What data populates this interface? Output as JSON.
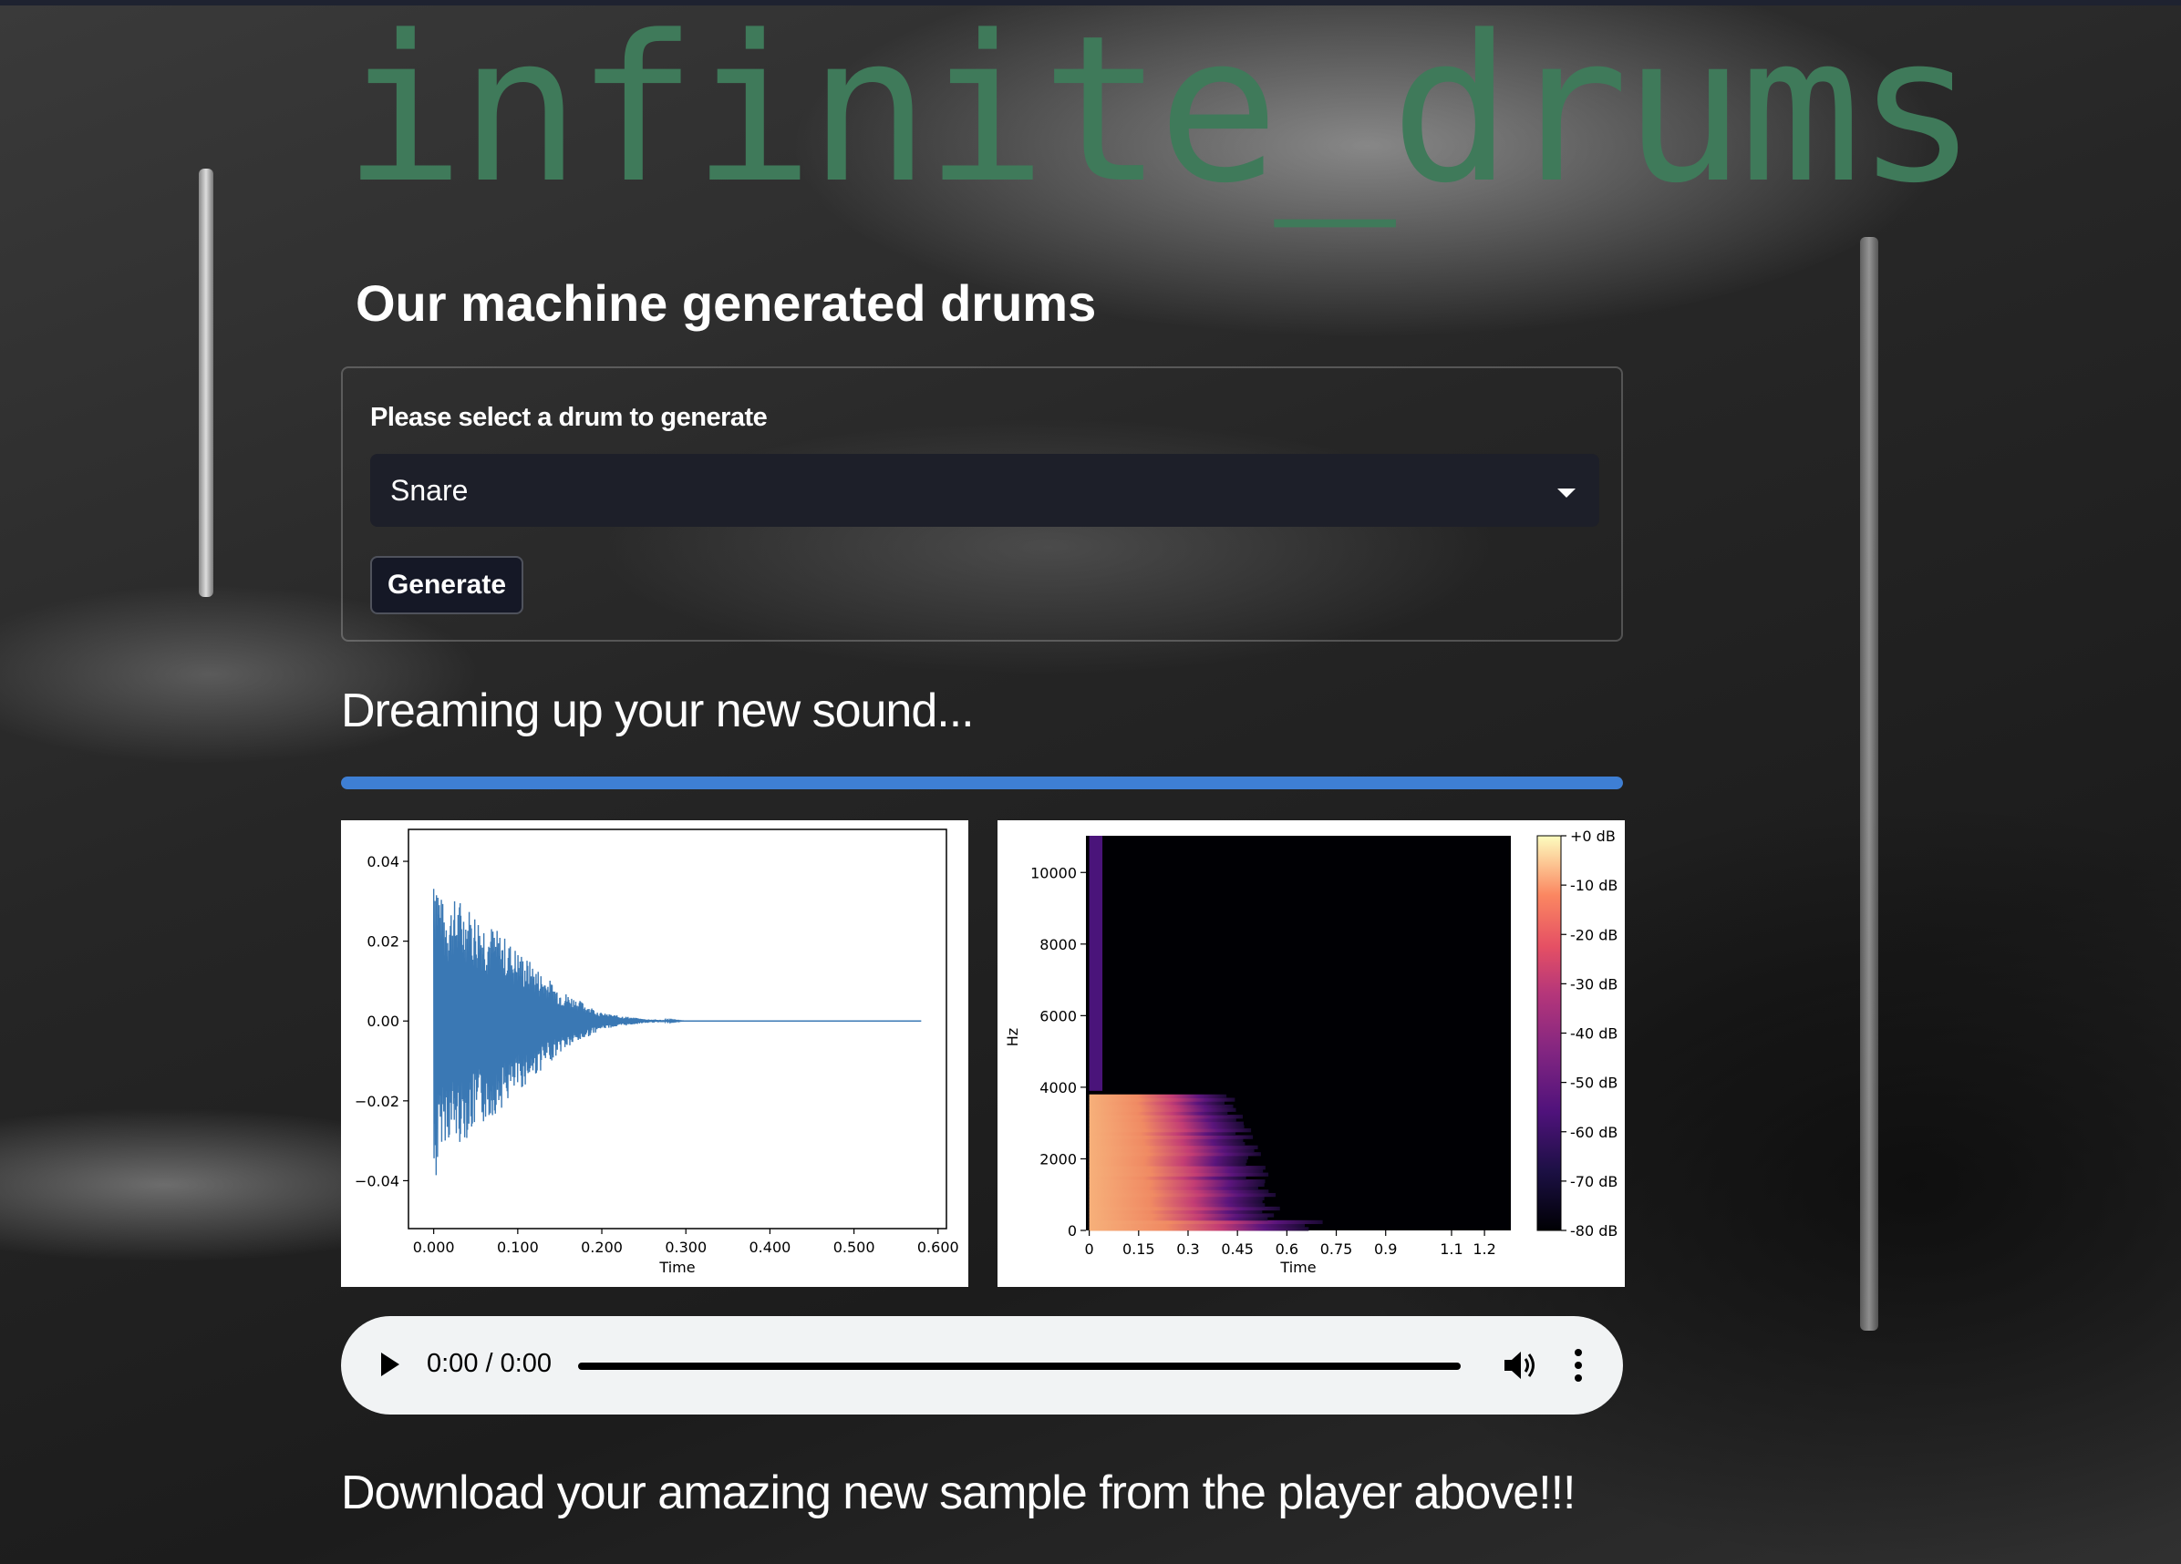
{
  "app": {
    "title": "infinite_drums"
  },
  "heading": "Our machine generated drums",
  "form": {
    "label": "Please select a drum to generate",
    "selected_drum": "Snare",
    "generate_label": "Generate"
  },
  "status": "Dreaming up your new sound...",
  "progress": {
    "percent": 100,
    "color": "#3e7fd4"
  },
  "chart_data": [
    {
      "type": "line",
      "title": "",
      "xlabel": "Time",
      "ylabel": "",
      "xlim": [
        -0.03,
        0.61
      ],
      "ylim": [
        -0.052,
        0.048
      ],
      "x_ticks": [
        "0.000",
        "0.100",
        "0.200",
        "0.300",
        "0.400",
        "0.500",
        "0.600"
      ],
      "y_ticks": [
        "0.04",
        "0.02",
        "0.00",
        "−0.02",
        "−0.04"
      ],
      "series": [
        {
          "color": "#3a78b4",
          "envelope": {
            "x": [
              0.0,
              0.01,
              0.03,
              0.06,
              0.1,
              0.15,
              0.2,
              0.25,
              0.3,
              0.58
            ],
            "y": [
              0.046,
              0.03,
              0.031,
              0.026,
              0.018,
              0.008,
              0.002,
              0.0005,
              0.0,
              0.0
            ]
          }
        }
      ]
    },
    {
      "type": "heatmap",
      "title": "",
      "xlabel": "Time",
      "ylabel": "Hz",
      "x_ticks": [
        "0",
        "0.15",
        "0.3",
        "0.45",
        "0.6",
        "0.75",
        "0.9",
        "1.1",
        "1.2"
      ],
      "y_ticks": [
        "10000",
        "8000",
        "6000",
        "4000",
        "2000",
        "0"
      ],
      "xlim": [
        -0.01,
        1.28
      ],
      "ylim": [
        0,
        11025
      ],
      "colorbar": {
        "labels": [
          "+0 dB",
          "-10 dB",
          "-20 dB",
          "-30 dB",
          "-40 dB",
          "-50 dB",
          "-60 dB",
          "-70 dB",
          "-80 dB"
        ],
        "range": [
          -80,
          0
        ]
      },
      "colormap": "magma"
    }
  ],
  "player": {
    "time": "0:00 / 0:00"
  },
  "footer": "Download your amazing new sample from the player above!!!"
}
